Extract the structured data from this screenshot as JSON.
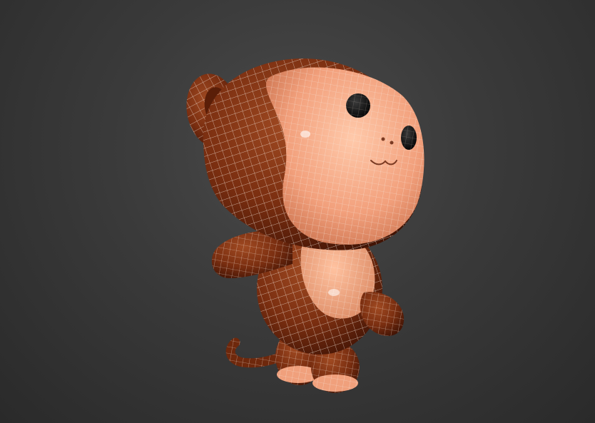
{
  "viewport": {
    "type": "3d-perspective-viewport",
    "background_top": "#4a4a4a",
    "background_bottom": "#2a2a2a",
    "wireframe_color": "#f2e6dc"
  },
  "model": {
    "subject": "monkey-character",
    "shading": "smooth-with-edged-faces",
    "colors": {
      "fur": "#7a2e10",
      "fur_dark": "#4a1806",
      "skin": "#f0a07c",
      "skin_light": "#ffc7a8",
      "eye": "#0d0d0d"
    }
  }
}
